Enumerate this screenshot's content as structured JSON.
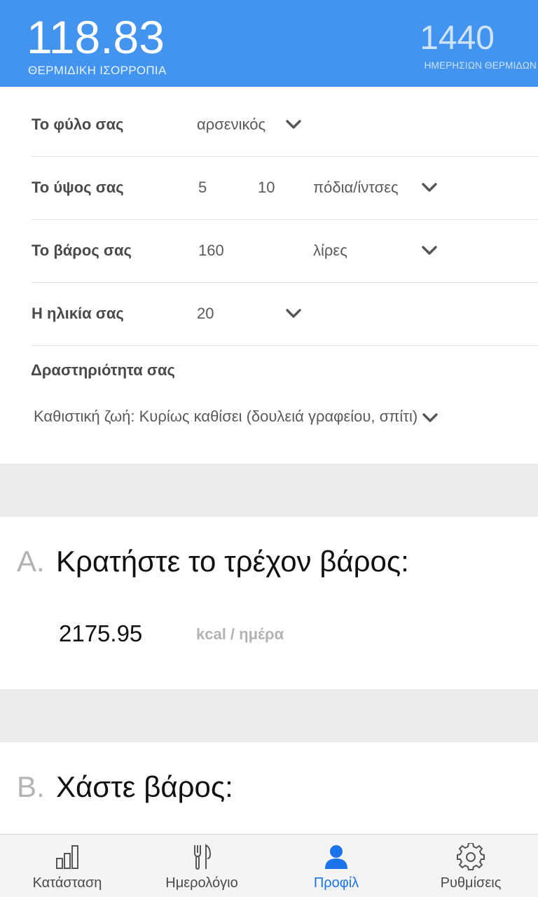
{
  "header": {
    "balance_value": "118.83",
    "balance_label": "ΘΕΡΜΙΔΙΚΗ ΙΣΟΡΡΟΠΙΑ",
    "daily_value": "1440",
    "daily_label": "ΗΜΕΡΗΣΙΩΝ ΘΕΡΜΙΔΩΝ"
  },
  "profile": {
    "gender": {
      "label": "Το φύλο σας",
      "value": "αρσενικός"
    },
    "height": {
      "label": "Το ύψος σας",
      "feet": "5",
      "inches": "10",
      "unit": "πόδια/ίντσες"
    },
    "weight": {
      "label": "Το βάρος σας",
      "value": "160",
      "unit": "λίρες"
    },
    "age": {
      "label": "Η ηλικία σας",
      "value": "20"
    },
    "activity": {
      "label": "Δραστηριότητα σας",
      "value": "Καθιστική ζωή: Κυρίως καθίσει (δουλειά γραφείου, σπίτι)"
    }
  },
  "section_a": {
    "letter": "A.",
    "title": "Κρατήστε το τρέχον βάρος:",
    "kcal_value": "2175.95",
    "kcal_unit": "kcal / ημέρα"
  },
  "section_b": {
    "letter": "B.",
    "title": "Χάστε βάρος:"
  },
  "nav": {
    "status": "Κατάσταση",
    "diary": "Ημερολόγιο",
    "profile": "Προφίλ",
    "settings": "Ρυθμίσεις",
    "active": "profile"
  },
  "colors": {
    "header_bg": "#4294ee",
    "accent": "#1a73e8",
    "muted": "#b3b3b3"
  },
  "icons": {
    "dropdown": "chevron-down-icon",
    "status": "bar-chart-icon",
    "diary": "fork-knife-icon",
    "profile": "person-icon",
    "settings": "gear-icon"
  }
}
